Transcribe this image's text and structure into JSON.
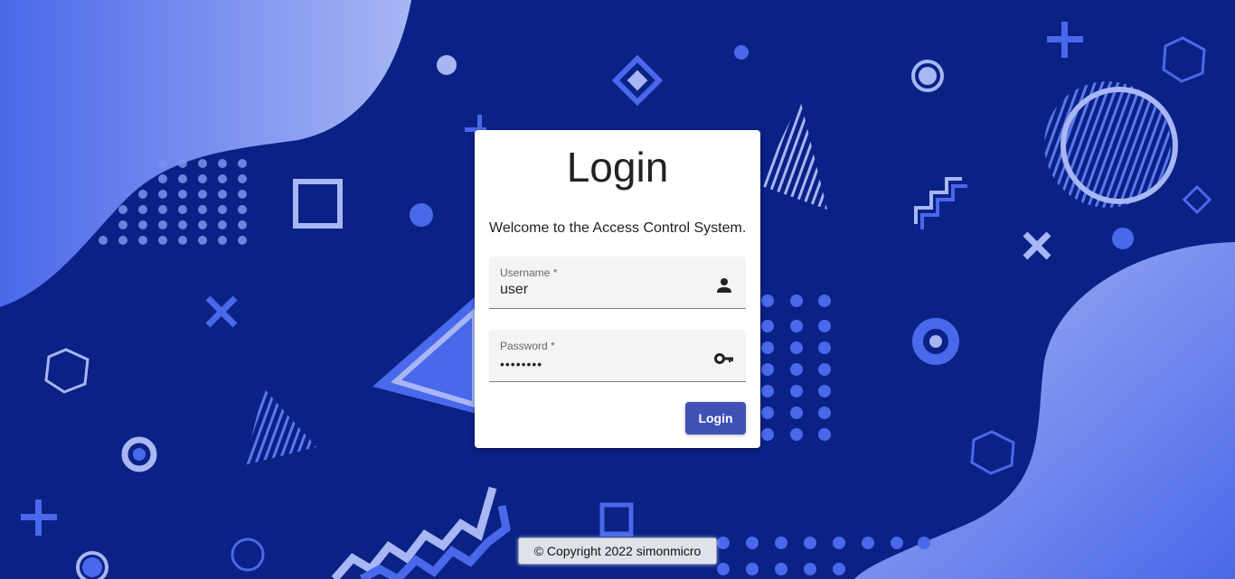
{
  "login": {
    "title": "Login",
    "welcome": "Welcome to the Access Control System.",
    "username_label": "Username *",
    "username_value": "user",
    "password_label": "Password *",
    "password_value": "••••••••",
    "submit_label": "Login"
  },
  "footer": {
    "copyright": "© Copyright 2022 simonmicro"
  },
  "colors": {
    "background": "#0a2185",
    "accent": "#3f51b5",
    "shape_light": "#a8b6f4",
    "shape_mid": "#4a68ea"
  },
  "icons": {
    "username": "person-icon",
    "password": "key-icon"
  }
}
